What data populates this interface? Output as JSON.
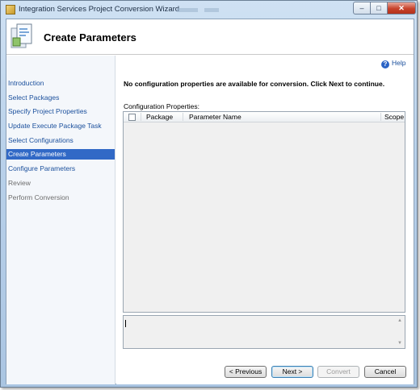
{
  "window": {
    "title": "Integration Services Project Conversion Wizard",
    "controls": {
      "minimize": "–",
      "maximize": "□",
      "close": "✕"
    }
  },
  "header": {
    "title": "Create Parameters"
  },
  "sidebar": {
    "items": [
      {
        "label": "Introduction",
        "state": "link"
      },
      {
        "label": "Select Packages",
        "state": "link"
      },
      {
        "label": "Specify Project Properties",
        "state": "link"
      },
      {
        "label": "Update Execute Package Task",
        "state": "link"
      },
      {
        "label": "Select Configurations",
        "state": "link"
      },
      {
        "label": "Create Parameters",
        "state": "active"
      },
      {
        "label": "Configure Parameters",
        "state": "link"
      },
      {
        "label": "Review",
        "state": "disabled"
      },
      {
        "label": "Perform Conversion",
        "state": "disabled"
      }
    ]
  },
  "main": {
    "help_label": "Help",
    "message": "No configuration properties are available for conversion. Click Next to continue.",
    "config_label": "Configuration Properties:",
    "grid": {
      "columns": [
        "Package",
        "Parameter Name",
        "Scope"
      ],
      "rows": []
    },
    "details_text": ""
  },
  "footer": {
    "previous_label": "< Previous",
    "next_label": "Next >",
    "convert_label": "Convert",
    "cancel_label": "Cancel"
  },
  "colors": {
    "selection": "#3169c6",
    "link": "#1a4f9c",
    "close_button": "#c7422b"
  }
}
